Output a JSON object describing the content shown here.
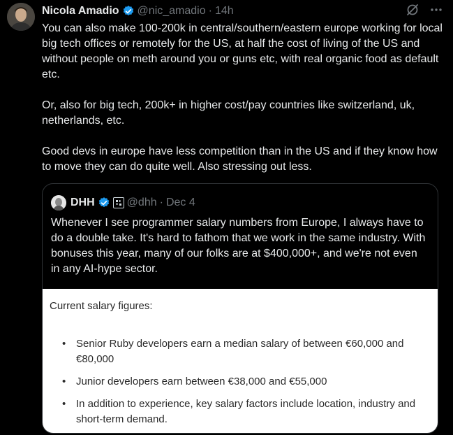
{
  "tweet": {
    "author": {
      "display_name": "Nicola Amadio",
      "handle": "@nic_amadio",
      "time": "14h",
      "separator": "·"
    },
    "paragraphs": [
      "You can also make 100-200k in central/southern/eastern europe working for local big tech offices or remotely for the US, at half the cost of living of the US and without people on meth around you or guns etc, with real organic food as default etc.",
      "Or, also for big tech, 200k+ in higher cost/pay countries like switzerland, uk, netherlands, etc.",
      "Good devs in europe have less competition than in the US and if they know how to move they can do quite well. Also stressing out less."
    ],
    "icons": [
      "grok-icon",
      "more-icon"
    ],
    "verified_color": "#1d9bf0"
  },
  "quote": {
    "author": {
      "display_name": "DHH",
      "handle": "@dhh",
      "date": "Dec 4",
      "separator": "·"
    },
    "text": "Whenever I see programmer salary numbers from Europe, I always have to do a double take. It's hard to fathom that we work in the same industry. With bonuses this year, many of our folks are at $400,000+, and we're not even in any AI-hype sector.",
    "image": {
      "heading": "Current salary figures:",
      "items": [
        "Senior Ruby developers earn a median salary of between €60,000 and €80,000",
        "Junior developers earn between €38,000 and €55,000",
        "In addition to experience, key salary factors include location, industry and short-term demand."
      ]
    }
  }
}
